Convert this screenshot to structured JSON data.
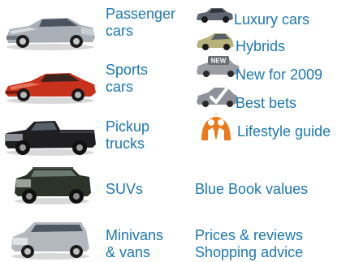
{
  "categories": {
    "passenger": {
      "line1": "Passenger",
      "line2": "cars",
      "image": "silver-sedan-photo"
    },
    "sports": {
      "line1": "Sports",
      "line2": "cars",
      "image": "red-sports-car-photo"
    },
    "pickup": {
      "line1": "Pickup",
      "line2": "trucks",
      "image": "black-pickup-truck-photo"
    },
    "suv": {
      "label": "SUVs",
      "image": "dark-suv-photo"
    },
    "minivan": {
      "line1": "Minivans",
      "line2": "& vans",
      "image": "silver-minivan-photo"
    }
  },
  "features": {
    "luxury": {
      "label": "Luxury cars",
      "icon": "luxury-car-icon"
    },
    "hybrids": {
      "label": "Hybrids",
      "icon": "hybrid-car-icon"
    },
    "new2009": {
      "label": "New for 2009",
      "icon": "new-badge-icon",
      "badge": "NEW"
    },
    "bestbets": {
      "label": "Best bets",
      "icon": "checkmark-car-icon"
    },
    "lifestyle": {
      "label": "Lifestyle guide",
      "icon": "lifestyle-people-icon"
    }
  },
  "resources": {
    "bluebook": "Blue Book values",
    "prices": "Prices & reviews",
    "shopping": "Shopping advice"
  },
  "colors": {
    "link": "#1c78b4"
  }
}
